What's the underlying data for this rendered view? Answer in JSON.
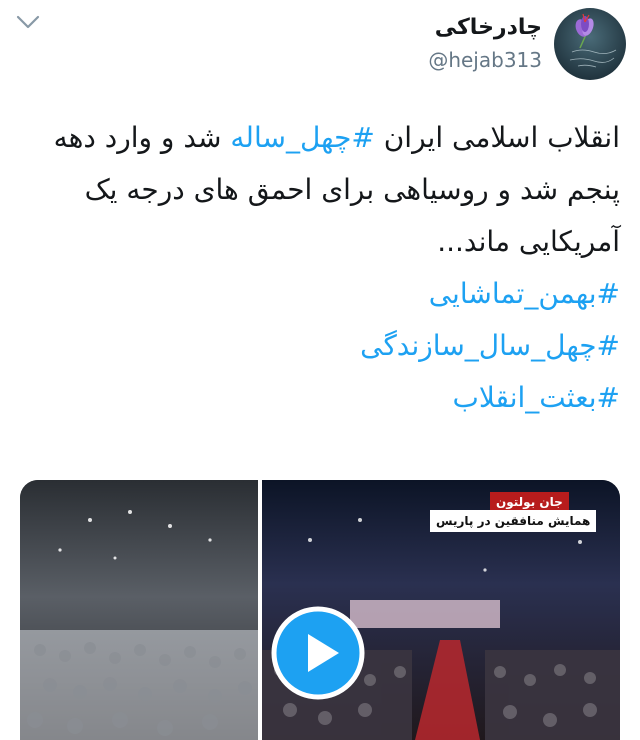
{
  "header": {
    "display_name": "چادرخاکی",
    "handle": "@hejab313"
  },
  "tweet": {
    "intro": "انقلاب اسلامی ایران ",
    "hashtag_inline": "#چهل_ساله",
    "rest": " شد و وارد دهه پنجم شد و روسیاهی برای احمق های درجه یک آمریکایی ماند...",
    "hashtags": [
      "#بهمن_تماشایی",
      "#چهل_سال_سازندگی",
      "#بعثت_انقلاب"
    ]
  },
  "media": {
    "overlay_title": "جان بولتون",
    "overlay_subtitle": "همایش منافقین در پاریس"
  },
  "icons": [
    "chevron-down-icon",
    "avatar-flower-icon",
    "play-icon"
  ],
  "colors": {
    "link": "#1da1f2",
    "text": "#14171a",
    "muted": "#657786",
    "play": "#1da1f2"
  }
}
